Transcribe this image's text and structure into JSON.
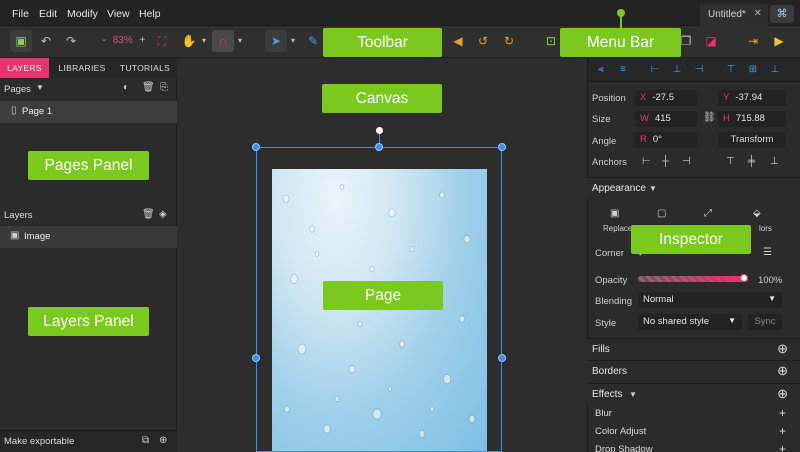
{
  "menubar": {
    "items": [
      "File",
      "Edit",
      "Modify",
      "View",
      "Help"
    ],
    "doc_tab": "Untitled*",
    "doc_tab_close": "✕"
  },
  "toolbar": {
    "zoom_minus": "-",
    "zoom_value": "83%",
    "zoom_plus": "+"
  },
  "left_panel": {
    "tabs": [
      "LAYERS",
      "LIBRARIES",
      "TUTORIALS"
    ],
    "pages_label": "Pages",
    "page_item": "Page 1",
    "layers_label": "Layers",
    "layer_item": "Image",
    "footer_label": "Make exportable"
  },
  "inspector": {
    "position_label": "Position",
    "x_key": "X",
    "x_value": "-27.5",
    "y_key": "Y",
    "y_value": "-37.94",
    "size_label": "Size",
    "w_key": "W",
    "w_value": "415",
    "h_key": "H",
    "h_value": "715.88",
    "angle_label": "Angle",
    "r_key": "R",
    "r_value": "0°",
    "transform_button": "Transform",
    "anchors_label": "Anchors",
    "appearance_label": "Appearance",
    "replace_label": "Replace",
    "fill_tools_tail": "lors",
    "corner_label": "Corner",
    "opacity_label": "Opacity",
    "opacity_value": "100%",
    "opacity_fraction": 1.0,
    "blending_label": "Blending",
    "blending_value": "Normal",
    "style_label": "Style",
    "style_value": "No shared style",
    "sync_button": "Sync",
    "fills_label": "Fills",
    "borders_label": "Borders",
    "effects_label": "Effects",
    "effects_items": [
      "Blur",
      "Color Adjust",
      "Drop Shadow"
    ]
  },
  "callouts": {
    "toolbar": "Toolbar",
    "menu_bar": "Menu Bar",
    "canvas": "Canvas",
    "pages_panel": "Pages Panel",
    "inspector": "Inspector",
    "page": "Page",
    "layers_panel": "Layers Panel"
  },
  "colors": {
    "accent_pink": "#e8336e",
    "callout_green": "#7bc91e",
    "selection_blue": "#3b8ef0"
  }
}
